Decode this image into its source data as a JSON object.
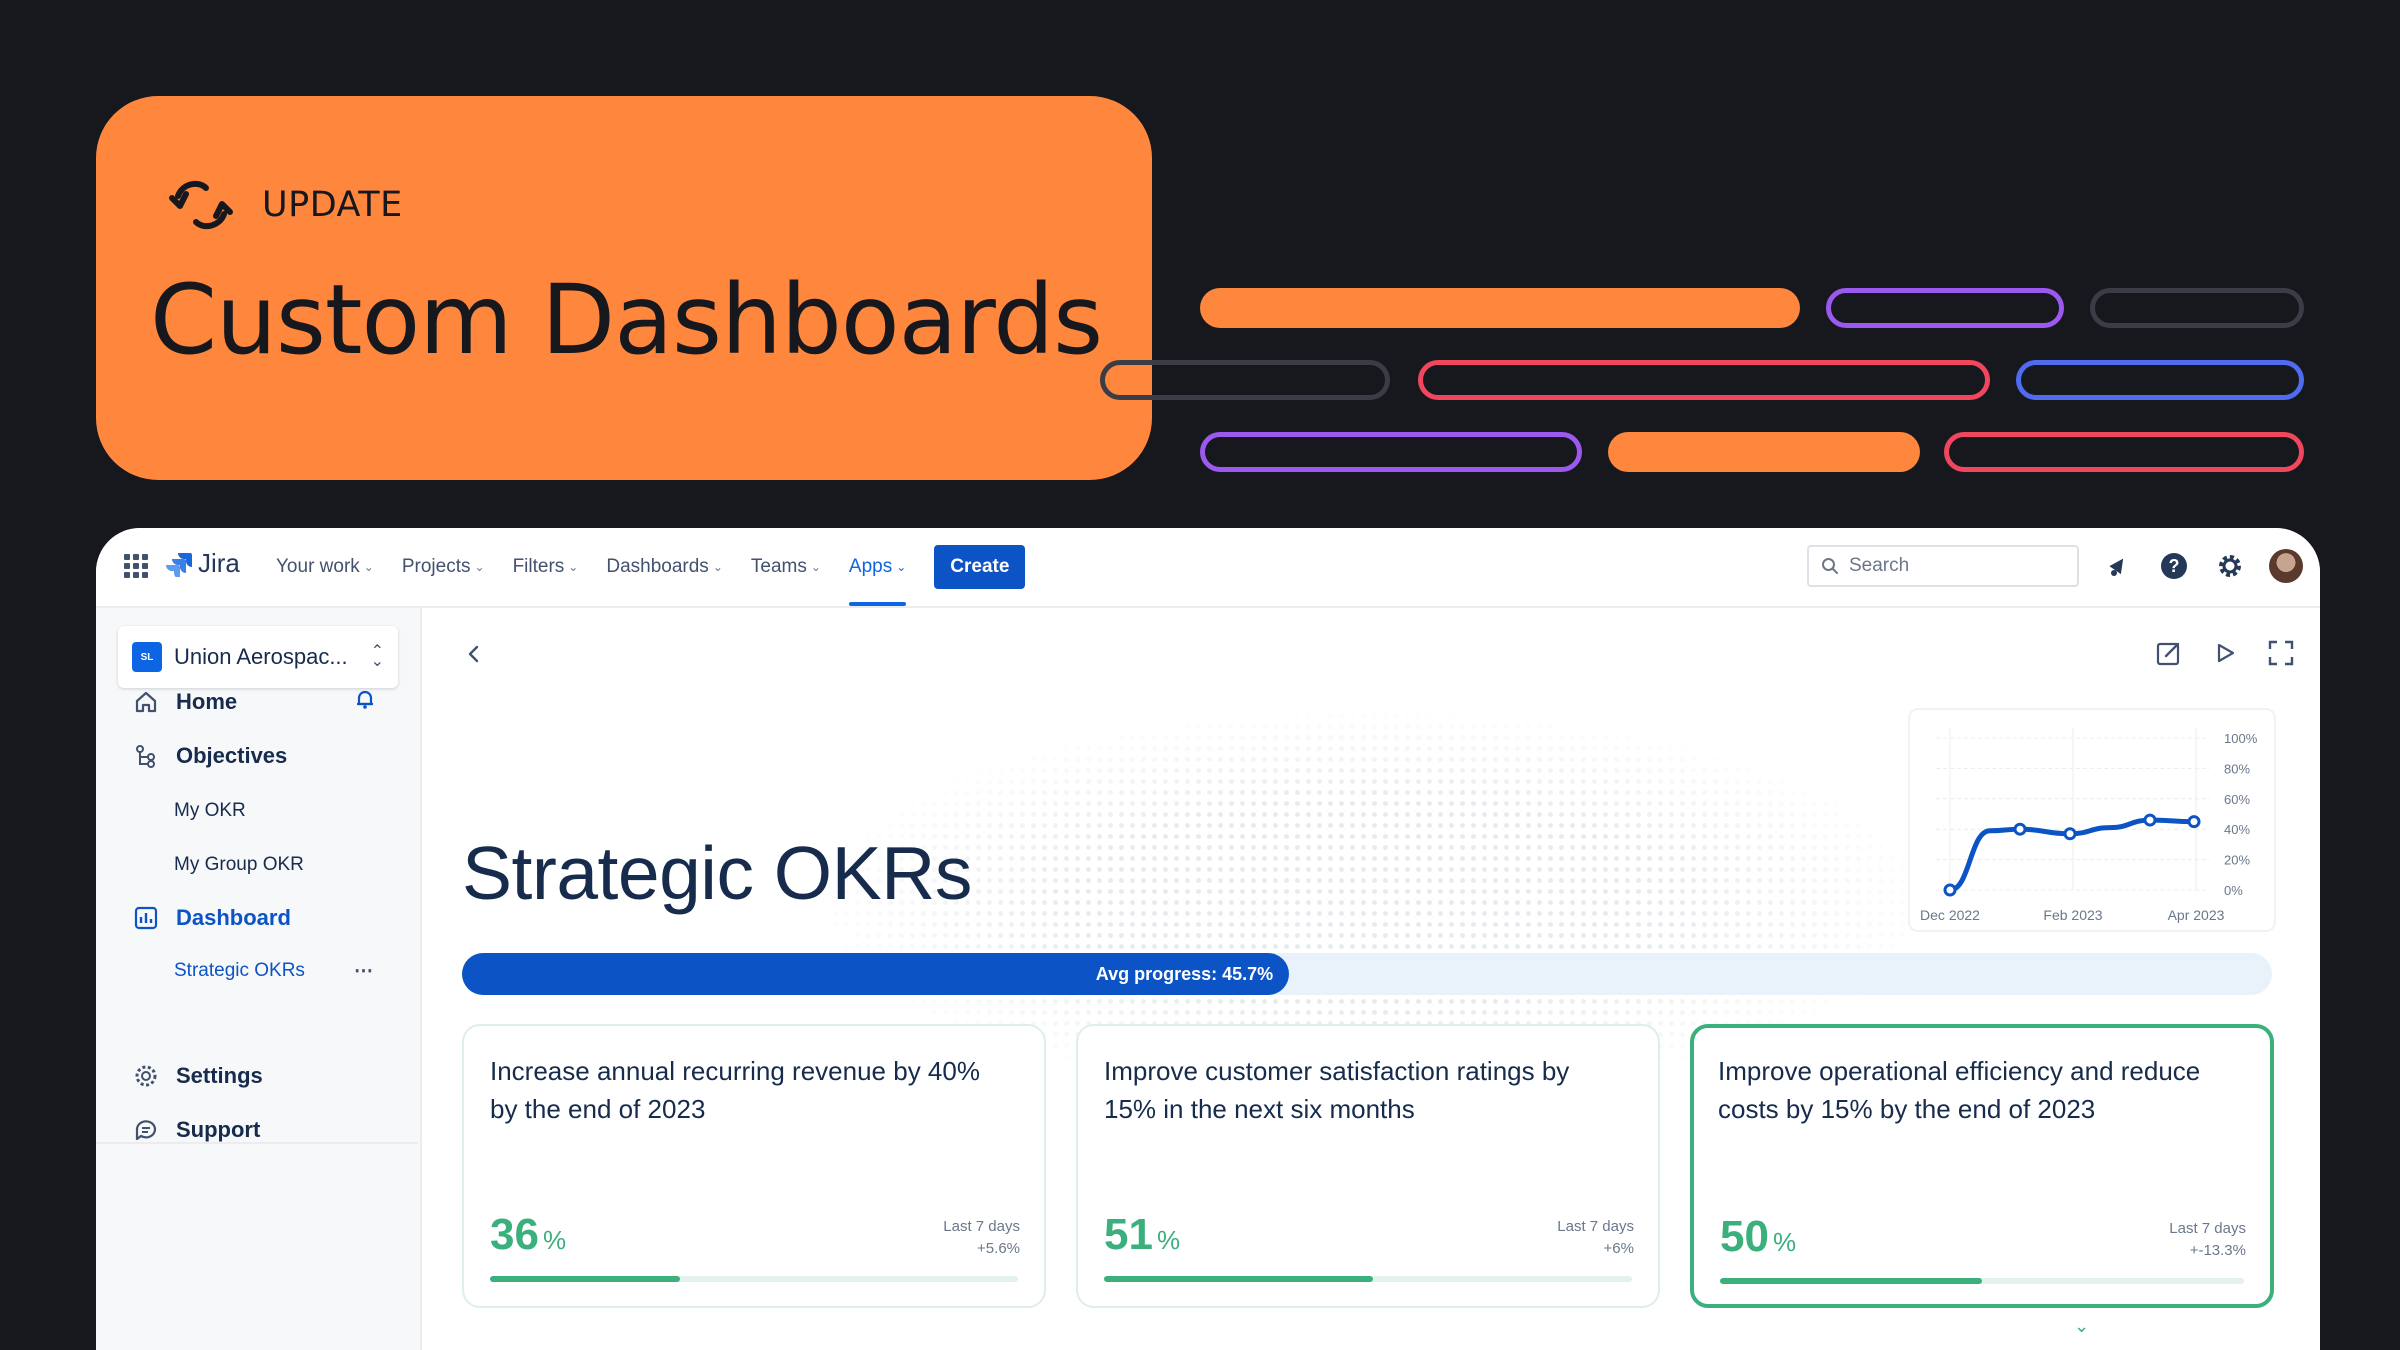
{
  "hero": {
    "tag": "UPDATE",
    "title": "Custom Dashboards"
  },
  "colors": {
    "background": "#17181e",
    "accent_orange": "#ff873d",
    "purple": "#9b59f0",
    "red": "#f0475e",
    "blue": "#4f6bf0",
    "dark_outline": "#3a3d45",
    "jira_blue": "#0c54c6",
    "success_green": "#3bb07d"
  },
  "app": {
    "product_name": "Jira",
    "nav": {
      "items": [
        {
          "label": "Your work"
        },
        {
          "label": "Projects"
        },
        {
          "label": "Filters"
        },
        {
          "label": "Dashboards"
        },
        {
          "label": "Teams"
        },
        {
          "label": "Apps",
          "active": true
        }
      ],
      "create_label": "Create",
      "search_placeholder": "Search",
      "icons": [
        "notifications-icon",
        "help-icon",
        "settings-icon",
        "avatar"
      ]
    },
    "sidebar": {
      "space_badge": "SL",
      "space_name": "Union Aerospac...",
      "items": [
        {
          "label": "Home",
          "icon": "home-icon"
        },
        {
          "label": "Objectives",
          "icon": "objectives-icon"
        },
        {
          "label": "My OKR"
        },
        {
          "label": "My Group OKR"
        },
        {
          "label": "Dashboard",
          "icon": "dashboard-icon"
        },
        {
          "label": "Strategic OKRs"
        },
        {
          "label": "Settings",
          "icon": "gear-icon"
        },
        {
          "label": "Support",
          "icon": "support-icon"
        }
      ]
    },
    "main": {
      "title": "Strategic OKRs",
      "avg_progress_label": "Avg progress: 45.7%",
      "avg_progress": 0.457,
      "mini_chart": {
        "x_labels": [
          "Dec 2022",
          "Feb 2023",
          "Apr 2023"
        ],
        "y_labels": [
          "100%",
          "80%",
          "60%",
          "40%",
          "20%",
          "0%"
        ],
        "values": [
          0,
          39,
          40,
          37,
          41,
          46,
          45
        ]
      },
      "okrs": [
        {
          "text": "Increase annual recurring revenue by 40% by the end of 2023",
          "pct": "36",
          "unit": "%",
          "meta_label": "Last 7 days",
          "meta_change": "+5.6%",
          "progress": 0.36
        },
        {
          "text": "Improve customer satisfaction ratings by 15% in the next six months",
          "pct": "51",
          "unit": "%",
          "meta_label": "Last 7 days",
          "meta_change": "+6%",
          "progress": 0.51
        },
        {
          "text": "Improve operational efficiency and reduce costs by 15% by the end of 2023",
          "pct": "50",
          "unit": "%",
          "meta_label": "Last 7 days",
          "meta_change": "+-13.3%",
          "progress": 0.5
        }
      ]
    }
  }
}
